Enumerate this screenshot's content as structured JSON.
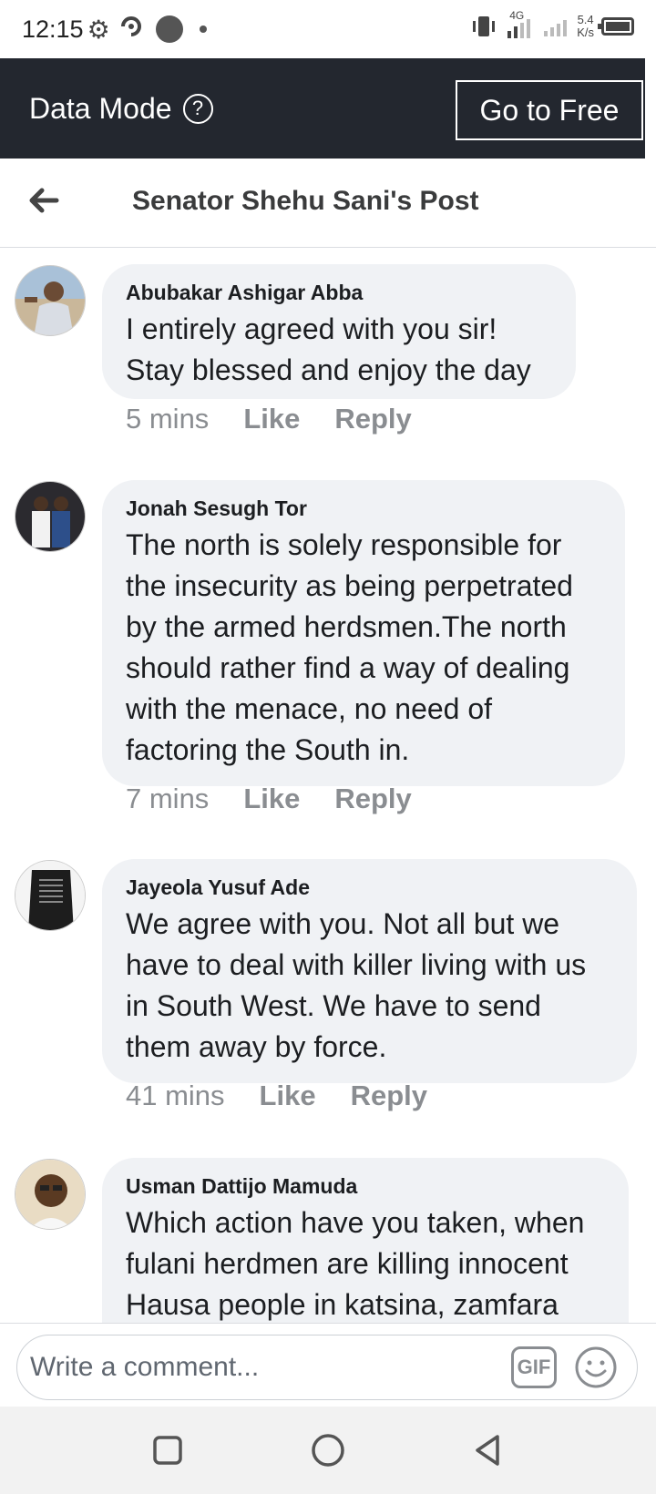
{
  "status_bar": {
    "time": "12:15",
    "network": "4G",
    "speed_value": "5.4",
    "speed_unit": "K/s"
  },
  "data_mode": {
    "title": "Data Mode",
    "help_icon": "?",
    "go_free_label": "Go to Free"
  },
  "header": {
    "title": "Senator Shehu Sani's Post"
  },
  "comments": [
    {
      "author": "Abubakar Ashigar Abba",
      "lines": [
        "I entirely agreed with you sir!",
        "Stay blessed and enjoy the day"
      ],
      "time": "5 mins",
      "like": "Like",
      "reply": "Reply"
    },
    {
      "author": "Jonah Sesugh Tor",
      "lines": [
        "The north is solely responsible for",
        "the insecurity as being perpetrated",
        "by the armed herdsmen.The north",
        "should rather find a way of dealing",
        "with the menace, no need of",
        "factoring the South in."
      ],
      "time": "7 mins",
      "like": "Like",
      "reply": "Reply"
    },
    {
      "author": "Jayeola Yusuf Ade",
      "lines": [
        "We agree with you. Not all but we",
        "have to deal with killer living with us",
        "in South West. We have to send",
        "them away by force."
      ],
      "time": "41 mins",
      "like": "Like",
      "reply": "Reply"
    },
    {
      "author": "Usman Dattijo Mamuda",
      "lines": [
        "Which action have you taken, when",
        "fulani herdmen are killing innocent",
        "Hausa people in katsina, zamfara"
      ],
      "time": "",
      "like": "",
      "reply": ""
    }
  ],
  "composer": {
    "placeholder": "Write a comment...",
    "gif_label": "GIF"
  },
  "icons": {
    "back": "back-arrow-icon",
    "help": "help-circle-icon",
    "emoji": "emoji-icon",
    "nav_recent": "square-icon",
    "nav_home": "circle-icon",
    "nav_back": "triangle-back-icon"
  },
  "colors": {
    "data_bar": "#23272f",
    "bubble": "#f0f2f5",
    "meta_text": "#8a8d91"
  }
}
